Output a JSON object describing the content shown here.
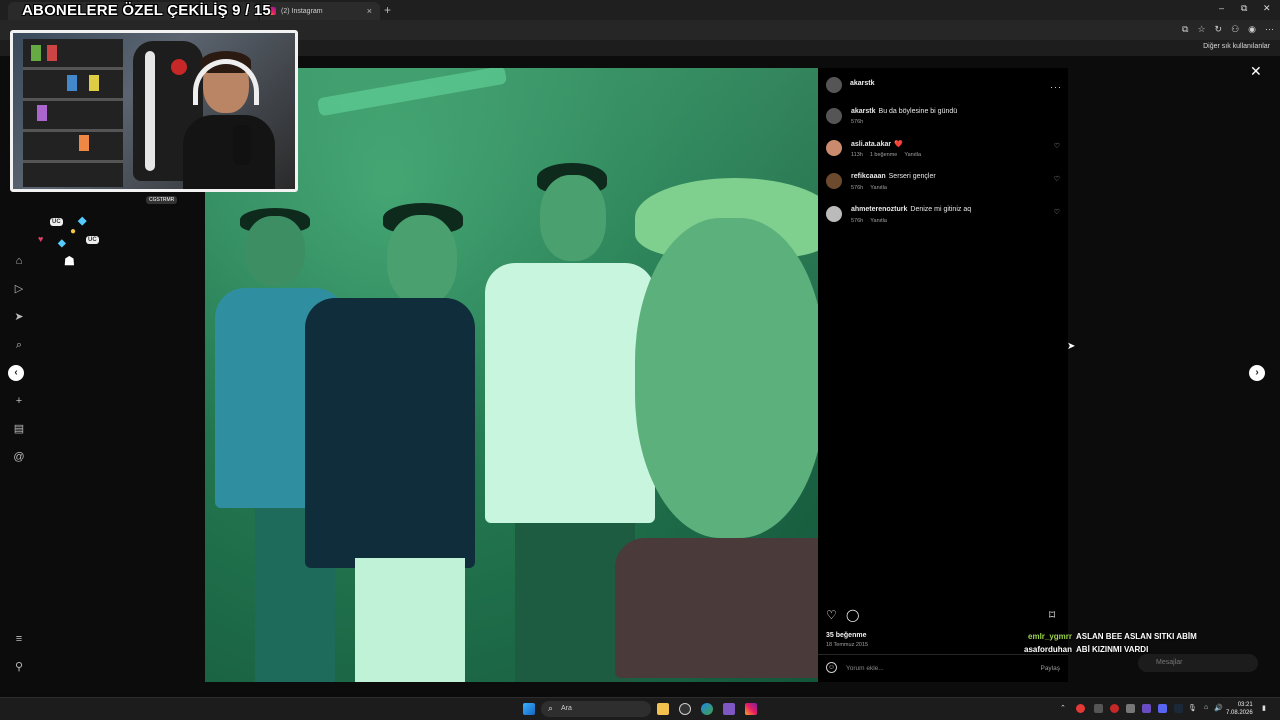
{
  "stream": {
    "title": "ABONELERE ÖZEL ÇEKİLİŞ 9 / 15"
  },
  "browser": {
    "tabs": [
      {
        "label": "",
        "close": "×"
      },
      {
        "label": "(2) Instagram",
        "close": "×"
      }
    ],
    "new_tab": "+",
    "window_controls": [
      "–",
      "⧉",
      "✕"
    ],
    "bookmarks_other": "Diğer sık kullanılanlar"
  },
  "webcam": {
    "tag": "CGSTRMR"
  },
  "emotes": [
    "UC",
    "UC",
    "UC"
  ],
  "post": {
    "author": "akarstk",
    "menu": "···",
    "comments": [
      {
        "user": "akarstk",
        "text": "Bu da böylesine bi gündü",
        "meta": [
          "576h"
        ]
      },
      {
        "user": "asli.ata.akar",
        "text": "❤️",
        "meta": [
          "113h",
          "1 beğenme",
          "Yanıtla"
        ]
      },
      {
        "user": "refikcaaan",
        "text": "Serseri gençler",
        "meta": [
          "576h",
          "Yanıtla"
        ]
      },
      {
        "user": "ahmeterenozturk",
        "text": "Denize mi gitiniz aq",
        "meta": [
          "576h",
          "Yanıtla"
        ]
      }
    ],
    "likes": "35 beğenme",
    "date": "18 Temmuz 2015",
    "add_comment_placeholder": "Yorum ekle...",
    "share_label": "Paylaş"
  },
  "chat": [
    {
      "nick": "emlr_ygmrr",
      "text": "ASLAN BEE ASLAN SITKI ABİM"
    },
    {
      "nick": "asaforduhan",
      "text": "ABİ KIZINMI VARDI"
    }
  ],
  "messages_label": "Mesajlar",
  "taskbar": {
    "search_label": "Ara"
  },
  "clock": {
    "time": "03:21",
    "date": "7.08.2026"
  },
  "colors": {
    "accent_green": "#9ad24a",
    "photo_tint": "#247a52",
    "panel_bg": "#000000"
  }
}
